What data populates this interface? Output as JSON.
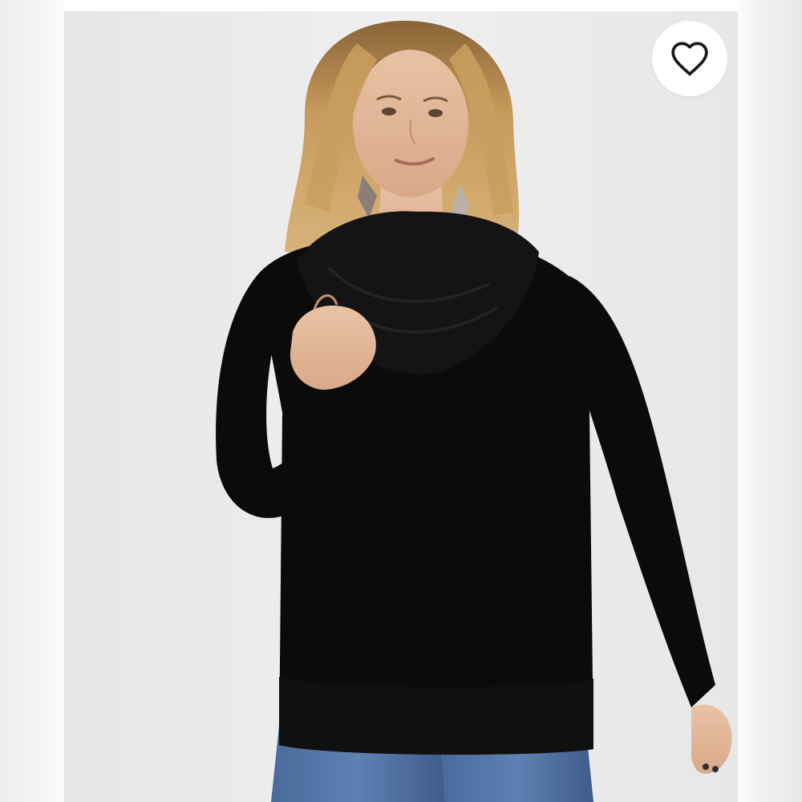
{
  "listing": {
    "photo": {
      "subject": "model-wearing-black-cowl-neck-sweater",
      "background_color": "#ececec",
      "sweater_color": "#0b0b0c",
      "jeans_color": "#3d5d8f",
      "hair_color": "#b88a4e"
    },
    "favorite": {
      "icon": "heart-outline-icon",
      "is_favorited": false,
      "icon_color": "#1a1a1a",
      "button_color": "#ffffff"
    }
  }
}
